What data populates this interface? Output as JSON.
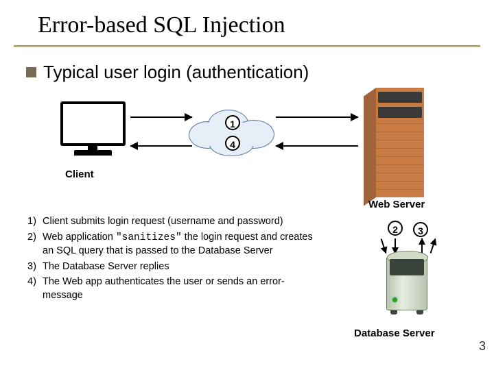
{
  "title": "Error-based SQL Injection",
  "bullet": "Typical user login (authentication)",
  "labels": {
    "client": "Client",
    "webserver": "Web Server",
    "dbserver": "Database Server"
  },
  "steps": {
    "s1": "1",
    "s2": "2",
    "s3": "3",
    "s4": "4"
  },
  "list": {
    "n1": "1)",
    "t1": "Client submits login request (username and password)",
    "n2": "2)",
    "t2a": "Web application ",
    "t2b": "\"sanitizes\"",
    "t2c": " the login request and creates an SQL query that is passed to the Database Server",
    "n3": "3)",
    "t3": "The Database Server replies",
    "n4": "4)",
    "t4": "The Web app authenticates the user or sends an error-message"
  },
  "page_number": "3"
}
